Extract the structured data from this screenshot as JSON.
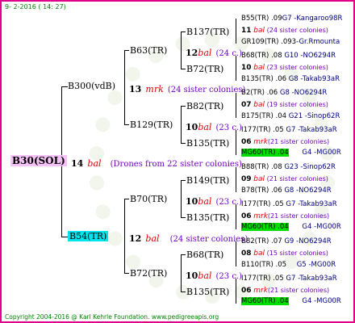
{
  "header": {
    "date": "9- 2-2016 ( 14: 27)"
  },
  "footer": {
    "copyright": "Copyright 2004-2016 @ Karl Kehrle Foundation.   www.pedigreeapis.org"
  },
  "root": {
    "label": "B30(SOL)",
    "num": "14",
    "kind": "bal",
    "note": "(Drones from 22 sister colonies)"
  },
  "father": {
    "label": "B300(vdB)",
    "num": "13",
    "kind": "mrk",
    "note": "(24 sister colonies)"
  },
  "mother": {
    "label": "B54(TR)",
    "num": "12",
    "kind": "bal",
    "note": "(24 sister colonies)"
  },
  "level2": {
    "n1": {
      "label": "B63(TR)",
      "num": "12",
      "kind": "bal",
      "note": "(24 c.)"
    },
    "n2": {
      "label": "B129(TR)",
      "num": "10",
      "kind": "bal",
      "note": "(23 c.)"
    },
    "n3": {
      "label": "B70(TR)",
      "num": "10",
      "kind": "bal",
      "note": "(23 c.)"
    },
    "n4": {
      "label": "B72(TR)",
      "num": "10",
      "kind": "bal",
      "note": "(23 c.)"
    }
  },
  "level3": {
    "a": "B137(TR)",
    "b": "B72(TR)",
    "c": "B82(TR)",
    "d": "B135(TR)",
    "e": "B149(TR)",
    "f": "B135(TR)",
    "g": "B68(TR)",
    "h": "B135(TR)"
  },
  "rows": [
    {
      "a": "B55(TR) .09",
      "b": "G7 -Kangaroo98R"
    },
    {
      "num": "11",
      "kind": "bal",
      "note": "(24 sister colonies)"
    },
    {
      "a": "GR109(TR) .093",
      "b": "-Gr.Rmounta"
    },
    {
      "a": "B68(TR) .08",
      "b": "G10 -NO6294R"
    },
    {
      "num": "10",
      "kind": "bal",
      "note": "(23 sister colonies)"
    },
    {
      "a": "B135(TR) .06",
      "b": "G8 -Takab93aR"
    },
    {
      "a": "B2(TR) .06",
      "b": "G8 -NO6294R"
    },
    {
      "num": "07",
      "kind": "bal",
      "note": "(19 sister colonies)"
    },
    {
      "a": "B175(TR) .04",
      "b": "G21 -Sinop62R"
    },
    {
      "a": "I177(TR) .05",
      "b": "G7 -Takab93aR"
    },
    {
      "num": "06",
      "kind": "mrk",
      "note": "(21 sister colonies)"
    },
    {
      "a": "MG60(TR) .04",
      "b": "G4 -MG00R"
    },
    {
      "a": "B88(TR) .08",
      "b": "G23 -Sinop62R"
    },
    {
      "num": "09",
      "kind": "bal",
      "note": "(21 sister colonies)"
    },
    {
      "a": "B78(TR) .06",
      "b": "G8 -NO6294R"
    },
    {
      "a": "I177(TR) .05",
      "b": "G7 -Takab93aR"
    },
    {
      "num": "06",
      "kind": "mrk",
      "note": "(21 sister colonies)"
    },
    {
      "a": "MG60(TR) .04",
      "b": "G4 -MG00R"
    },
    {
      "a": "B82(TR) .07",
      "b": "G9 -NO6294R"
    },
    {
      "num": "08",
      "kind": "bal",
      "note": "(15 sister colonies)"
    },
    {
      "a": "B110(TR) .05",
      "b": "G5 -MG00R"
    },
    {
      "a": "I177(TR) .05",
      "b": "G7 -Takab93aR"
    },
    {
      "num": "06",
      "kind": "mrk",
      "note": "(21 sister colonies)"
    },
    {
      "a": "MG60(TR) .04",
      "b": "G4 -MG00R"
    }
  ]
}
